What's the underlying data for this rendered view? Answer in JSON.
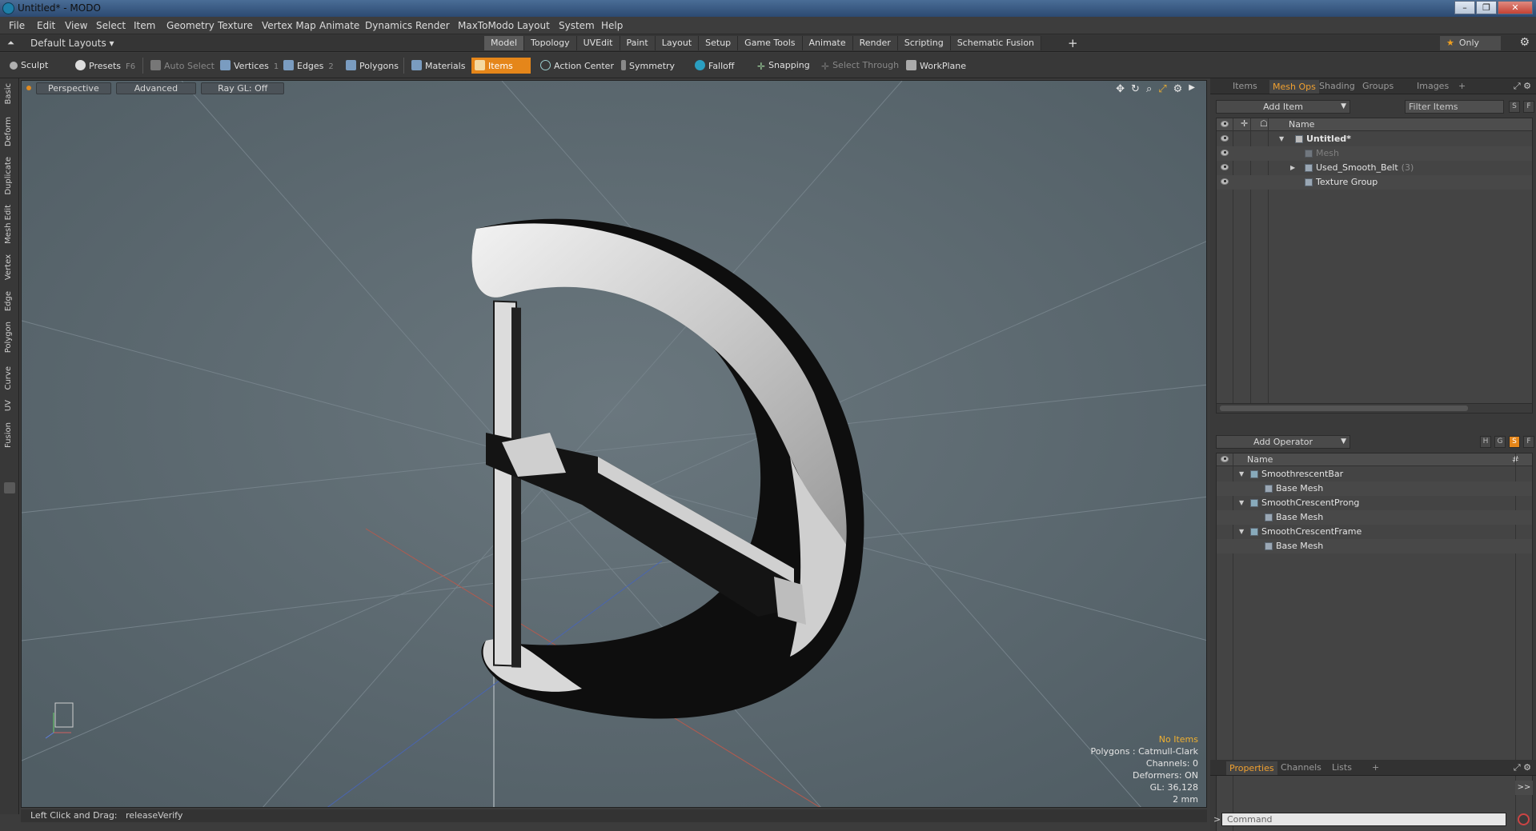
{
  "window": {
    "title": "Untitled* - MODO",
    "controls": [
      "–",
      "❐",
      "✕"
    ]
  },
  "menubar": [
    "File",
    "Edit",
    "View",
    "Select",
    "Item",
    "Geometry",
    "Texture",
    "Vertex Map",
    "Animate",
    "Dynamics",
    "Render",
    "MaxToModo",
    "Layout",
    "System",
    "Help"
  ],
  "layoutbar": {
    "layout": "Default Layouts ▾",
    "tabs": [
      "Model",
      "Topology",
      "UVEdit",
      "Paint",
      "Layout",
      "Setup",
      "Game Tools",
      "Animate",
      "Render",
      "Scripting",
      "Schematic Fusion"
    ],
    "active_tab": "Model",
    "plus": "+",
    "only": "Only"
  },
  "toolbar": {
    "sculpt": "Sculpt",
    "presets": "Presets",
    "presets_key": "F6",
    "auto_select": "Auto Select",
    "vertices": "Vertices",
    "vertices_key": "1",
    "edges": "Edges",
    "edges_key": "2",
    "polygons": "Polygons",
    "materials": "Materials",
    "items": "Items",
    "action_center": "Action Center",
    "symmetry": "Symmetry",
    "falloff": "Falloff",
    "snapping": "Snapping",
    "select_through": "Select Through",
    "workplane": "WorkPlane"
  },
  "left_tabs": [
    "Basic",
    "Deform",
    "Duplicate",
    "Mesh Edit",
    "Vertex",
    "Edge",
    "Polygon",
    "Curve",
    "UV",
    "Fusion"
  ],
  "viewport": {
    "perspective": "Perspective",
    "advanced": "Advanced",
    "raygl": "Ray GL: Off",
    "info": {
      "no_items": "No Items",
      "polygons": "Polygons : Catmull-Clark",
      "channels": "Channels: 0",
      "deformers": "Deformers: ON",
      "gl": "GL: 36,128",
      "scale": "2 mm"
    },
    "colors": {
      "background": "#5c6a72",
      "buckle_light": "#d4d4d4",
      "buckle_dark": "#101010"
    }
  },
  "status": {
    "hint": "Left Click and Drag:",
    "action": "releaseVerify"
  },
  "items_panel": {
    "tabs": [
      "Items",
      "Mesh Ops",
      "Shading",
      "Groups",
      "Images"
    ],
    "active_tab": "Mesh Ops",
    "add_item": "Add Item",
    "filter_placeholder": "Filter Items",
    "s": "S",
    "f": "F",
    "col_name": "Name",
    "rows": [
      {
        "label": "Untitled*",
        "count": ""
      },
      {
        "label": "Mesh",
        "count": ""
      },
      {
        "label": "Used_Smooth_Belt",
        "count": "(3)"
      },
      {
        "label": "Texture Group",
        "count": ""
      }
    ]
  },
  "operators_panel": {
    "add_operator": "Add Operator",
    "btns": [
      "H",
      "G",
      "S",
      "F"
    ],
    "col_name": "Name",
    "col_hash": "#",
    "rows": [
      {
        "label": "SmoothrescentBar"
      },
      {
        "label": "Base Mesh"
      },
      {
        "label": "SmoothCrescentProng"
      },
      {
        "label": "Base Mesh"
      },
      {
        "label": "SmoothCrescentFrame"
      },
      {
        "label": "Base Mesh"
      }
    ]
  },
  "props_panel": {
    "tabs": [
      "Properties",
      "Channels",
      "Lists"
    ],
    "active_tab": "Properties",
    "command_placeholder": "Command",
    "expand": ">>"
  }
}
